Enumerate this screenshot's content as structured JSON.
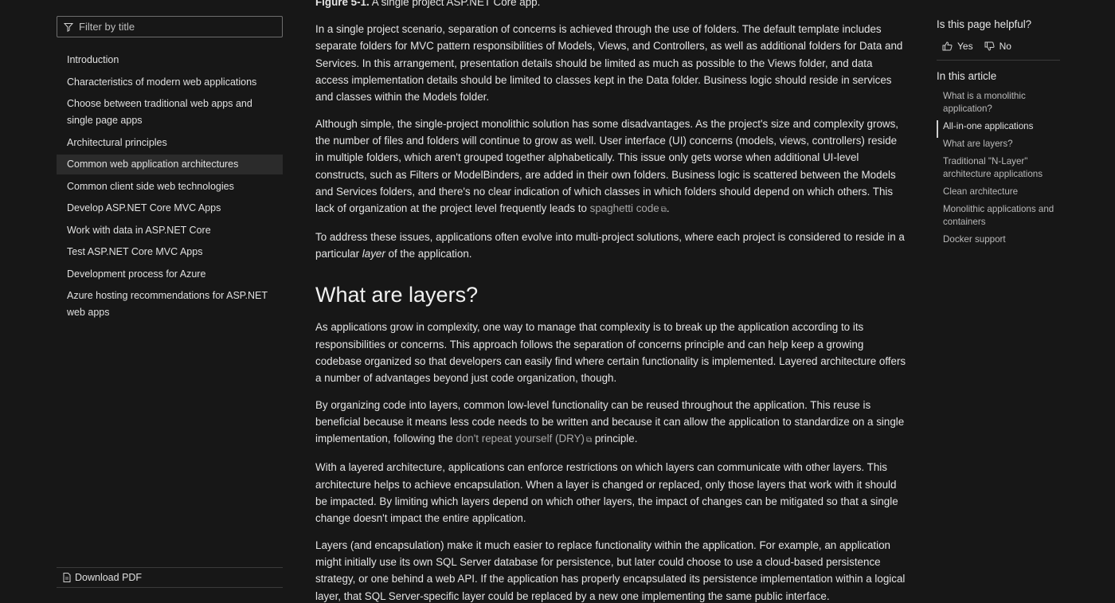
{
  "sidebar": {
    "filter_placeholder": "Filter by title",
    "items": [
      {
        "label": "Introduction"
      },
      {
        "label": "Characteristics of modern web applications"
      },
      {
        "label": "Choose between traditional web apps and single page apps"
      },
      {
        "label": "Architectural principles"
      },
      {
        "label": "Common web application architectures",
        "active": true
      },
      {
        "label": "Common client side web technologies"
      },
      {
        "label": "Develop ASP.NET Core MVC Apps"
      },
      {
        "label": "Work with data in ASP.NET Core"
      },
      {
        "label": "Test ASP.NET Core MVC Apps"
      },
      {
        "label": "Development process for Azure"
      },
      {
        "label": "Azure hosting recommendations for ASP.NET web apps"
      }
    ],
    "download_label": "Download PDF"
  },
  "main": {
    "caption_label": "Figure 5-1.",
    "caption_text": " A single project ASP.NET Core app.",
    "p1": "In a single project scenario, separation of concerns is achieved through the use of folders. The default template includes separate folders for MVC pattern responsibilities of Models, Views, and Controllers, as well as additional folders for Data and Services. In this arrangement, presentation details should be limited as much as possible to the Views folder, and data access implementation details should be limited to classes kept in the Data folder. Business logic should reside in services and classes within the Models folder.",
    "p2_text": "Although simple, the single-project monolithic solution has some disadvantages. As the project's size and complexity grows, the number of files and folders will continue to grow as well. User interface (UI) concerns (models, views, controllers) reside in multiple folders, which aren't grouped together alphabetically. This issue only gets worse when additional UI-level constructs, such as Filters or ModelBinders, are added in their own folders. Business logic is scattered between the Models and Services folders, and there's no clear indication of which classes in which folders should depend on which others. This lack of organization at the project level frequently leads to ",
    "p2_link": "spaghetti code",
    "p2_end": ".",
    "p3_text": "To address these issues, applications often evolve into multi-project solutions, where each project is considered to reside in a particular ",
    "p3_em": "layer",
    "p3_end": " of the application.",
    "h2": "What are layers?",
    "p4": "As applications grow in complexity, one way to manage that complexity is to break up the application according to its responsibilities or concerns. This approach follows the separation of concerns principle and can help keep a growing codebase organized so that developers can easily find where certain functionality is implemented. Layered architecture offers a number of advantages beyond just code organization, though.",
    "p5_text": "By organizing code into layers, common low-level functionality can be reused throughout the application. This reuse is beneficial because it means less code needs to be written and because it can allow the application to standardize on a single implementation, following the ",
    "p5_link": "don't repeat yourself (DRY)",
    "p5_end": " principle.",
    "p6": "With a layered architecture, applications can enforce restrictions on which layers can communicate with other layers. This architecture helps to achieve encapsulation. When a layer is changed or replaced, only those layers that work with it should be impacted. By limiting which layers depend on which other layers, the impact of changes can be mitigated so that a single change doesn't impact the entire application.",
    "p7": "Layers (and encapsulation) make it much easier to replace functionality within the application. For example, an application might initially use its own SQL Server database for persistence, but later could choose to use a cloud-based persistence strategy, or one behind a web API. If the application has properly encapsulated its persistence implementation within a logical layer, that SQL Server-specific layer could be replaced by a new one implementing the same public interface."
  },
  "rail": {
    "helpful_title": "Is this page helpful?",
    "yes_label": "Yes",
    "no_label": "No",
    "in_article_title": "In this article",
    "items": [
      {
        "label": "What is a monolithic application?"
      },
      {
        "label": "All-in-one applications",
        "current": true
      },
      {
        "label": "What are layers?"
      },
      {
        "label": "Traditional \"N-Layer\" architecture applications"
      },
      {
        "label": "Clean architecture"
      },
      {
        "label": "Monolithic applications and containers"
      },
      {
        "label": "Docker support"
      }
    ]
  },
  "icons": {
    "filter": "filter-icon",
    "download": "pdf-icon",
    "like": "thumbs-up-icon",
    "dislike": "thumbs-down-icon",
    "external": "external-link-icon"
  },
  "colors": {
    "background": "#171717",
    "active_nav": "#2b2b2b",
    "link": "#a8a8a8"
  }
}
